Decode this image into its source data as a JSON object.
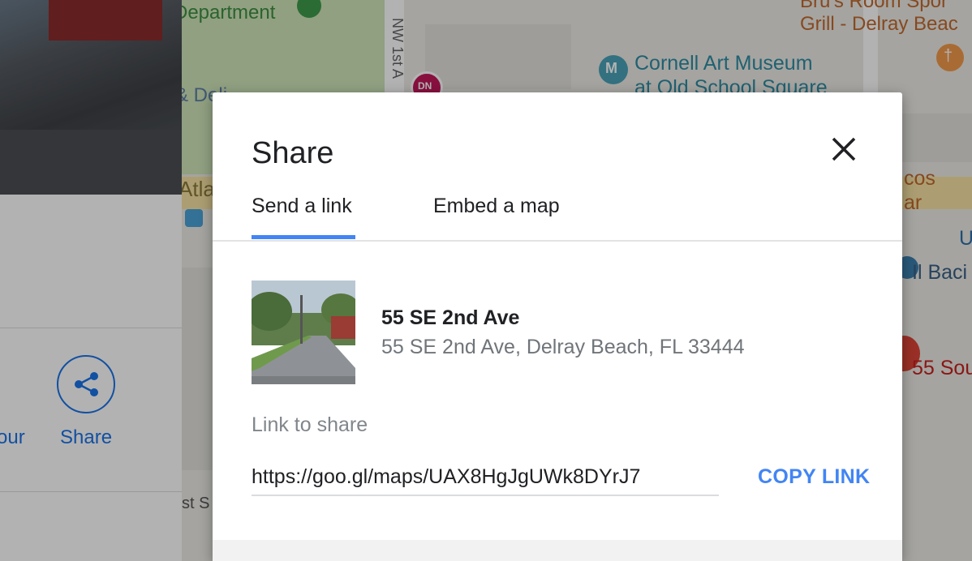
{
  "left_panel": {
    "partial_action_label": "our",
    "share_action_label": "Share"
  },
  "map": {
    "labels": {
      "department": "Department",
      "deli": "& Deli",
      "nw_1st": "NW 1st A",
      "dn_badge": "DN",
      "brus_line1": "Bru's Room Spor",
      "brus_line2": "Grill - Delray Beac",
      "cornell_line1": "Cornell Art Museum",
      "cornell_line2": "at Old School Square",
      "atla": "Atla",
      "tacos_line1": "cos",
      "tacos_line2": "ar",
      "u_letter": "U",
      "il_bacio": "Il Baci",
      "fifty_five_sou": "55 Sou",
      "st_s": "st S"
    },
    "colors": {
      "park": "#cfe5b9",
      "poi_red": "#db4437",
      "poi_teal": "#4aa3b8",
      "restaurant_orange": "#f29a4b",
      "road_yellow": "#f6e3a4"
    }
  },
  "dialog": {
    "title": "Share",
    "close_icon": "close-icon",
    "tabs": [
      {
        "label": "Send a link",
        "active": true
      },
      {
        "label": "Embed a map",
        "active": false
      }
    ],
    "place": {
      "name": "55 SE 2nd Ave",
      "address": "55 SE 2nd Ave, Delray Beach, FL 33444"
    },
    "link_label": "Link to share",
    "link_value": "https://goo.gl/maps/UAX8HgJgUWk8DYrJ7",
    "copy_button": "COPY LINK",
    "accent_color": "#4285f4"
  }
}
